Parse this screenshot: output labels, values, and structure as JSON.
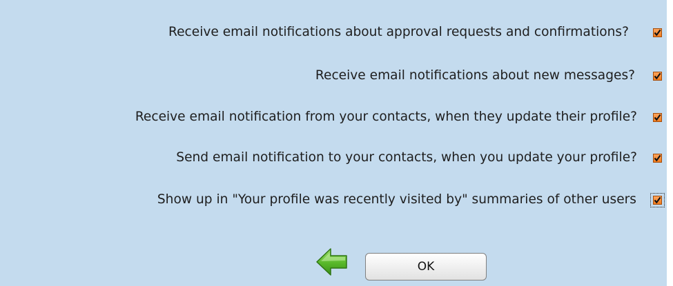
{
  "settings": [
    {
      "label": "Receive email notifications about approval requests and confirmations?",
      "checked": true,
      "focused": false
    },
    {
      "label": "Receive email notifications about new messages?",
      "checked": true,
      "focused": false
    },
    {
      "label": "Receive email notification from your contacts, when they update their profile?",
      "checked": true,
      "focused": false
    },
    {
      "label": "Send email notification to your contacts, when you update your profile?",
      "checked": true,
      "focused": false
    },
    {
      "label": "Show up in \"Your profile was recently visited by\" summaries of other users",
      "checked": true,
      "focused": true
    }
  ],
  "actions": {
    "back_icon": "green-left-arrow",
    "ok_label": "OK"
  },
  "colors": {
    "background": "#c4dbee",
    "checkbox_fill": "#f27c1e",
    "arrow_green": "#58b82a"
  }
}
